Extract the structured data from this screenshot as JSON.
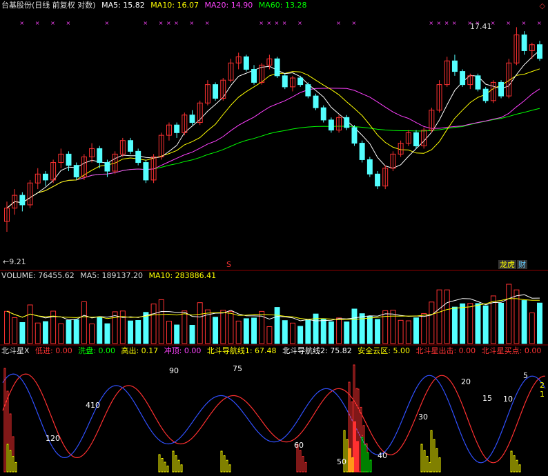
{
  "header": {
    "title": "台基股份(日线 前复权 对数)",
    "ma5": "MA5: 15.82",
    "ma10": "MA10: 16.07",
    "ma20": "MA20: 14.90",
    "ma60": "MA60: 13.28"
  },
  "price_annotations": {
    "high": "17.41",
    "low": "9.21"
  },
  "corner_icon": "diamond-icon",
  "tags": {
    "s_marker": "S",
    "longhu": "龙虎",
    "cai": "财"
  },
  "volume": {
    "label": "VOLUME: 76455.62",
    "ma5": "MA5: 189137.20",
    "ma10": "MA10: 283886.41"
  },
  "indicator": {
    "name": "北斗星X",
    "di_jin": "低进: 0.00",
    "xi_pan": "洗盘: 0.00",
    "gao_chu": "高出: 0.17",
    "chong_ding": "冲顶: 0.00",
    "nav1": "北斗导航线1: 67.48",
    "nav2": "北斗导航线2: 75.82",
    "safe_zone": "安全云区: 5.00",
    "star_out": "北斗星出击: 0.00",
    "star_buy": "北斗星买点: 0.00",
    "numbers": [
      "120",
      "410",
      "90",
      "75",
      "60",
      "50",
      "40",
      "30",
      "20",
      "15",
      "10",
      "5",
      "2",
      "1"
    ]
  },
  "colors": {
    "background": "#000000",
    "up": "#ff3232",
    "down": "#54ffff",
    "ma5": "#ffffff",
    "ma10": "#ffff00",
    "ma20": "#ff40ff",
    "ma60": "#00ff00",
    "separator": "#8b0000"
  },
  "chart_data": {
    "type": "candlestick",
    "price_range": [
      9.21,
      17.41
    ],
    "series_note": "daily OHLC approximated from screenshot",
    "ohlc": [
      [
        9.6,
        10.2,
        9.3,
        10.0
      ],
      [
        10.0,
        10.6,
        9.8,
        10.4
      ],
      [
        10.4,
        10.5,
        9.9,
        10.1
      ],
      [
        10.1,
        10.9,
        10.0,
        10.8
      ],
      [
        10.8,
        11.3,
        10.6,
        11.1
      ],
      [
        11.1,
        11.2,
        10.7,
        10.9
      ],
      [
        10.9,
        11.6,
        10.8,
        11.5
      ],
      [
        11.5,
        12.0,
        11.3,
        11.8
      ],
      [
        11.8,
        11.9,
        11.2,
        11.4
      ],
      [
        11.4,
        11.5,
        10.9,
        11.0
      ],
      [
        11.0,
        11.8,
        10.9,
        11.7
      ],
      [
        11.7,
        12.2,
        11.5,
        12.0
      ],
      [
        12.0,
        12.1,
        11.3,
        11.5
      ],
      [
        11.5,
        11.6,
        11.0,
        11.2
      ],
      [
        11.2,
        11.9,
        11.1,
        11.8
      ],
      [
        11.8,
        12.4,
        11.7,
        12.3
      ],
      [
        12.3,
        12.4,
        11.8,
        11.9
      ],
      [
        11.9,
        12.0,
        11.4,
        11.5
      ],
      [
        11.5,
        11.6,
        10.8,
        10.9
      ],
      [
        10.9,
        11.8,
        10.8,
        11.7
      ],
      [
        11.7,
        12.6,
        11.6,
        12.5
      ],
      [
        12.5,
        13.0,
        12.3,
        12.9
      ],
      [
        12.9,
        13.0,
        12.4,
        12.6
      ],
      [
        12.6,
        13.4,
        12.5,
        13.3
      ],
      [
        13.3,
        13.5,
        12.9,
        13.0
      ],
      [
        13.0,
        13.9,
        12.9,
        13.8
      ],
      [
        13.8,
        14.8,
        13.7,
        14.6
      ],
      [
        14.6,
        14.7,
        13.9,
        14.0
      ],
      [
        14.0,
        14.9,
        13.9,
        14.8
      ],
      [
        14.8,
        15.8,
        14.7,
        15.6
      ],
      [
        15.6,
        16.1,
        15.3,
        15.9
      ],
      [
        15.9,
        16.0,
        15.2,
        15.3
      ],
      [
        15.3,
        15.5,
        14.6,
        14.7
      ],
      [
        14.7,
        15.6,
        14.6,
        15.5
      ],
      [
        15.5,
        16.0,
        15.3,
        15.8
      ],
      [
        15.8,
        15.9,
        14.9,
        15.0
      ],
      [
        15.0,
        15.1,
        14.4,
        14.5
      ],
      [
        14.5,
        15.0,
        14.3,
        14.9
      ],
      [
        14.9,
        15.0,
        14.5,
        14.6
      ],
      [
        14.6,
        14.7,
        14.0,
        14.1
      ],
      [
        14.1,
        14.2,
        13.5,
        13.6
      ],
      [
        13.6,
        13.7,
        13.0,
        13.1
      ],
      [
        13.1,
        13.2,
        12.6,
        12.7
      ],
      [
        12.7,
        13.3,
        12.6,
        13.2
      ],
      [
        13.2,
        13.3,
        12.7,
        12.8
      ],
      [
        12.8,
        12.9,
        12.1,
        12.2
      ],
      [
        12.2,
        12.3,
        11.5,
        11.6
      ],
      [
        11.6,
        11.7,
        11.0,
        11.1
      ],
      [
        11.1,
        11.2,
        10.6,
        10.7
      ],
      [
        10.7,
        11.4,
        10.6,
        11.3
      ],
      [
        11.3,
        11.9,
        11.2,
        11.8
      ],
      [
        11.8,
        12.3,
        11.7,
        12.2
      ],
      [
        12.2,
        12.7,
        12.1,
        12.6
      ],
      [
        12.6,
        12.7,
        12.0,
        12.1
      ],
      [
        12.1,
        12.8,
        12.0,
        12.7
      ],
      [
        12.7,
        13.6,
        12.6,
        13.5
      ],
      [
        13.5,
        14.8,
        13.4,
        14.6
      ],
      [
        14.6,
        15.9,
        14.5,
        15.7
      ],
      [
        15.7,
        16.0,
        15.0,
        15.2
      ],
      [
        15.2,
        15.3,
        14.5,
        14.6
      ],
      [
        14.6,
        15.1,
        14.4,
        15.0
      ],
      [
        15.0,
        15.1,
        14.3,
        14.4
      ],
      [
        14.4,
        14.5,
        13.8,
        13.9
      ],
      [
        13.9,
        14.8,
        13.8,
        14.7
      ],
      [
        14.7,
        14.8,
        14.0,
        14.1
      ],
      [
        14.1,
        15.8,
        14.0,
        15.6
      ],
      [
        15.6,
        17.41,
        15.5,
        17.0
      ],
      [
        17.0,
        17.2,
        16.0,
        16.2
      ],
      [
        16.2,
        16.6,
        15.8,
        16.5
      ],
      [
        16.5,
        16.7,
        15.7,
        15.82
      ]
    ]
  }
}
